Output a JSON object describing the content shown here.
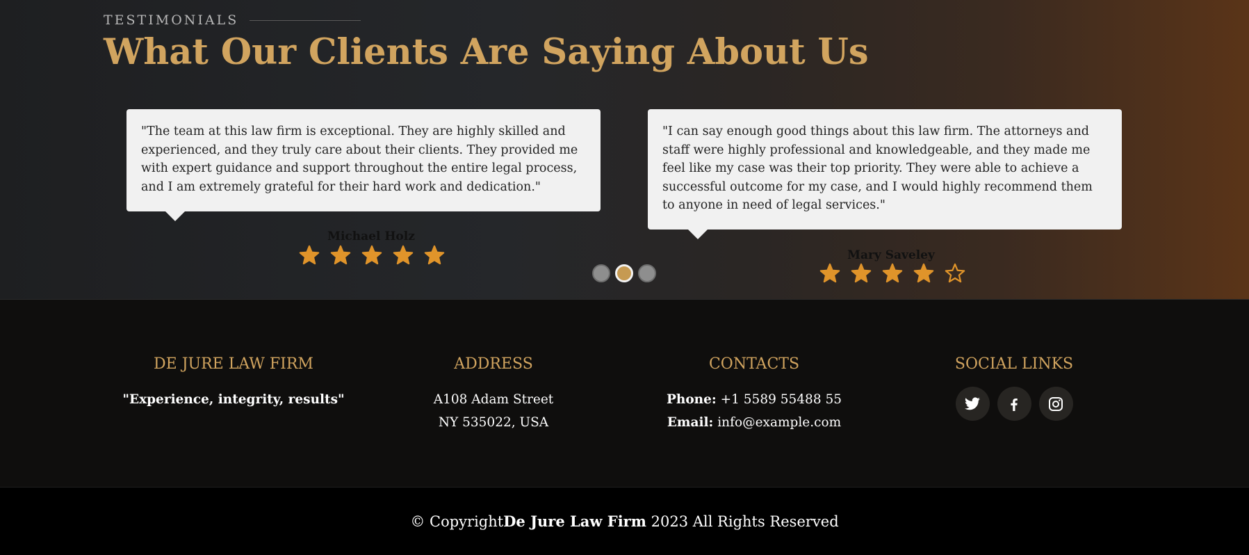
{
  "testimonials": {
    "label": "TESTIMONIALS",
    "title": "What Our Clients Are Saying About Us",
    "items": [
      {
        "quote": "\"The team at this law firm is exceptional. They are highly skilled and experienced, and they truly care about their clients. They provided me with expert guidance and support throughout the entire legal process, and I am extremely grateful for their hard work and dedication.\"",
        "author": "Michael Holz",
        "rating": 5,
        "rating_max": 5
      },
      {
        "quote": "\"I can say enough good things about this law firm. The attorneys and staff were highly professional and knowledgeable, and they made me feel like my case was their top priority. They were able to achieve a successful outcome for my case, and I would highly recommend them to anyone in need of legal services.\"",
        "author": "Mary Saveley",
        "rating": 4,
        "rating_max": 5
      }
    ],
    "pagination": {
      "count": 3,
      "active_index": 1
    },
    "colors": {
      "accent": "#d1a45f",
      "star": "#e0942a"
    }
  },
  "footer": {
    "firm": {
      "heading": "DE JURE LAW FIRM",
      "tagline": "\"Experience, integrity, results\""
    },
    "address": {
      "heading": "ADDRESS",
      "line1": "A108 Adam Street",
      "line2": "NY 535022, USA"
    },
    "contacts": {
      "heading": "CONTACTS",
      "phone_label": "Phone:",
      "phone": "+1 5589 55488 55",
      "email_label": "Email:",
      "email": "info@example.com"
    },
    "social": {
      "heading": "SOCIAL LINKS",
      "icons": [
        "twitter-icon",
        "facebook-icon",
        "instagram-icon"
      ]
    },
    "copyright": {
      "prefix": "© Copyright",
      "firm": "De Jure Law Firm",
      "suffix": " 2023 All Rights Reserved"
    }
  }
}
